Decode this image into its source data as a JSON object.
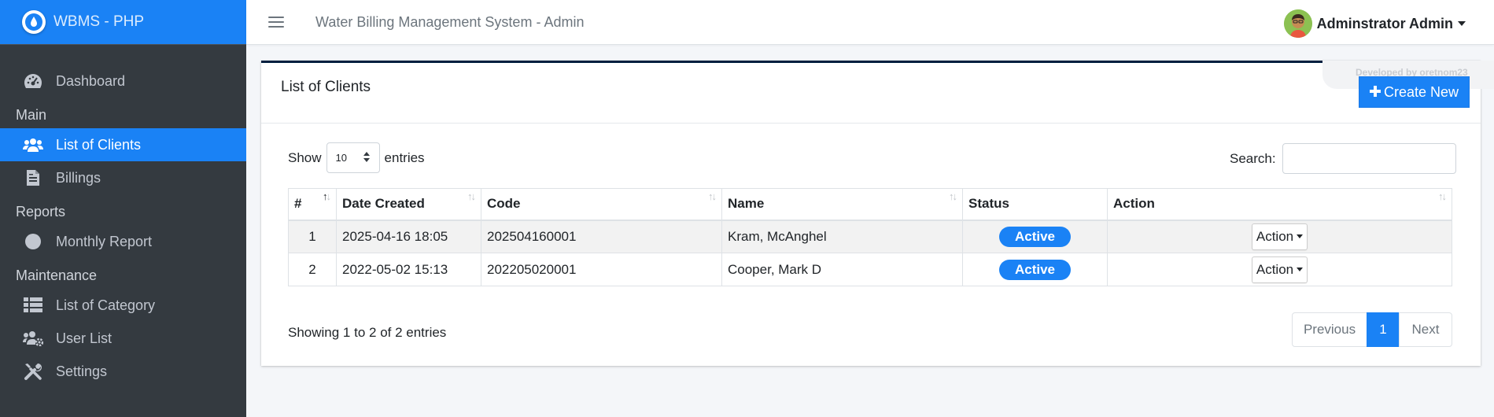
{
  "brand": {
    "name": "WBMS - PHP"
  },
  "header": {
    "title": "Water Billing Management System - Admin",
    "user": "Adminstrator Admin"
  },
  "sidebar": {
    "items": [
      {
        "label": "Dashboard",
        "icon": "tachometer-icon"
      },
      {
        "header": "Main"
      },
      {
        "label": "List of Clients",
        "icon": "users-icon",
        "active": true
      },
      {
        "label": "Billings",
        "icon": "file-invoice-icon"
      },
      {
        "header": "Reports"
      },
      {
        "label": "Monthly Report",
        "icon": "circle-icon"
      },
      {
        "header": "Maintenance"
      },
      {
        "label": "List of Category",
        "icon": "table-list-icon"
      },
      {
        "label": "User List",
        "icon": "users-cog-icon"
      },
      {
        "label": "Settings",
        "icon": "tools-icon"
      }
    ]
  },
  "card": {
    "title": "List of Clients",
    "developer_note": "Developed by oretnom23",
    "create_label": "Create New"
  },
  "table_controls": {
    "show_label": "Show",
    "page_length": "10",
    "entries_label": "entries",
    "search_label": "Search:",
    "search_value": ""
  },
  "table": {
    "columns": [
      "#",
      "Date Created",
      "Code",
      "Name",
      "Status",
      "Action"
    ],
    "rows": [
      {
        "num": "1",
        "date": "2025-04-16 18:05",
        "code": "202504160001",
        "name": "Kram, McAnghel",
        "status": "Active",
        "action": "Action"
      },
      {
        "num": "2",
        "date": "2022-05-02 15:13",
        "code": "202205020001",
        "name": "Cooper, Mark D",
        "status": "Active",
        "action": "Action"
      }
    ]
  },
  "pagination": {
    "info": "Showing 1 to 2 of 2 entries",
    "previous": "Previous",
    "current": "1",
    "next": "Next"
  },
  "colors": {
    "primary": "#1a82f5",
    "sidebar_bg": "#343a40",
    "card_top_border": "#001f3f"
  }
}
